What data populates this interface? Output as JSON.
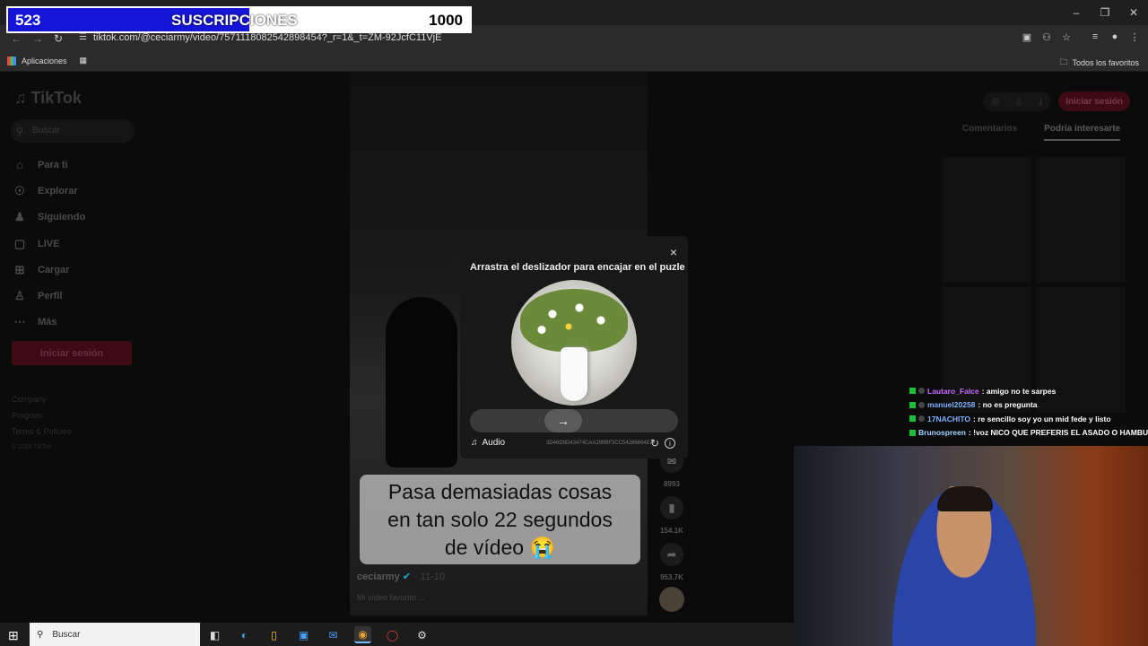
{
  "sub_counter": {
    "current": "523",
    "label": "SUSCRIPCIONES",
    "goal": "1000",
    "progress": 0.523
  },
  "browser": {
    "url": "tiktok.com/@ceciarmy/video/7571118082542898454?_r=1&_t=ZM-92JcfC11VjE",
    "tab_add": "+",
    "bookmarks_apps": "Aplicaciones",
    "bookmarks_all": "Todos los favoritos",
    "window_controls": [
      "minimize-icon",
      "restore-icon",
      "close-icon"
    ]
  },
  "tiktok": {
    "logo": "TikTok",
    "search_placeholder": "Buscar",
    "nav": [
      {
        "label": "Para ti",
        "icon": "home-icon"
      },
      {
        "label": "Explorar",
        "icon": "compass-icon"
      },
      {
        "label": "Siguiendo",
        "icon": "following-icon"
      },
      {
        "label": "LIVE",
        "icon": "live-icon"
      },
      {
        "label": "Cargar",
        "icon": "upload-icon"
      },
      {
        "label": "Perfil",
        "icon": "profile-icon"
      },
      {
        "label": "Más",
        "icon": "more-icon"
      }
    ],
    "login_button": "Iniciar sesión",
    "footer": [
      "Company",
      "Program",
      "Terms & Policies"
    ],
    "copyright": "© 2025 TikTok",
    "top_login": "Iniciar sesión",
    "right_tabs": {
      "comments": "Comentarios",
      "interest": "Podría interesarte"
    },
    "video": {
      "caption_lines": [
        "Pasa demasiadas cosas",
        "en tan solo 22 segundos",
        "de vídeo 😭"
      ],
      "author": "ceciarmy",
      "date": "· 11-10",
      "description": "Mi vídeo favorito ...",
      "stats": {
        "comments": "8993",
        "saves": "154.1K",
        "shares": "953.7K"
      }
    }
  },
  "captcha": {
    "title": "Arrastra el deslizador para encajar en el puzle",
    "close": "×",
    "slider_arrow": "→",
    "audio_label": "Audio",
    "code": "3D46D9D43474CAA299BF3CC54286664EA",
    "slider_position": 0.4
  },
  "chat": [
    {
      "user": "Lautaro_Falce",
      "user_color": "#c86cff",
      "message": "amigo no te sarpes"
    },
    {
      "user": "manuel20258",
      "user_color": "#7fb0ff",
      "message": "no es pregunta"
    },
    {
      "user": "17NACHITO",
      "user_color": "#7fb0ff",
      "message": "re sencillo soy yo un mid fede y listo"
    },
    {
      "user": "Brunospreen",
      "user_color": "#9fd4ff",
      "message": "!voz NICO QUE PREFERIS EL ASADO O HAMBURG"
    }
  ],
  "taskbar": {
    "search_placeholder": "Buscar"
  }
}
